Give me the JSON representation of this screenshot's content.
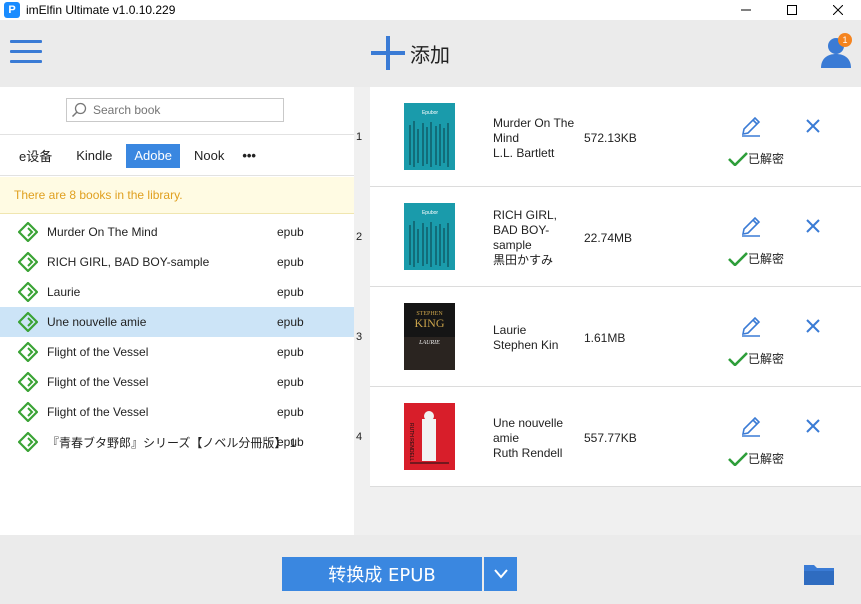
{
  "window": {
    "title": "imElfin Ultimate v1.0.10.229",
    "app_icon_letter": "P",
    "minimize_icon": "minimize-icon",
    "maximize_icon": "maximize-icon",
    "close_icon": "close-icon"
  },
  "header": {
    "add_label": "添加",
    "notification_count": "1",
    "accent_color": "#3a7bd5",
    "badge_color": "#f5841f"
  },
  "search": {
    "placeholder": "Search book"
  },
  "tabs": [
    {
      "label": "e设备",
      "active": false
    },
    {
      "label": "Kindle",
      "active": false
    },
    {
      "label": "Adobe",
      "active": true
    },
    {
      "label": "Nook",
      "active": false
    },
    {
      "label": "•••",
      "active": false
    }
  ],
  "notice": "There are 8 books in the library.",
  "library": [
    {
      "title": "Murder On The Mind",
      "format": "epub",
      "selected": false
    },
    {
      "title": "RICH GIRL, BAD BOY-sample",
      "format": "epub",
      "selected": false
    },
    {
      "title": "Laurie",
      "format": "epub",
      "selected": false
    },
    {
      "title": "Une nouvelle amie",
      "format": "epub",
      "selected": true
    },
    {
      "title": "Flight of the Vessel",
      "format": "epub",
      "selected": false
    },
    {
      "title": "Flight of the Vessel",
      "format": "epub",
      "selected": false
    },
    {
      "title": "Flight of the Vessel",
      "format": "epub",
      "selected": false
    },
    {
      "title": "『青春ブタ野郎』シリーズ【ノベル分冊版】 1",
      "format": "epub",
      "selected": false
    }
  ],
  "conversion": [
    {
      "num": "1",
      "lines": [
        "Murder On The",
        "Mind",
        "L.L. Bartlett"
      ],
      "size": "572.13KB",
      "status": "已解密",
      "cover": "epubor"
    },
    {
      "num": "2",
      "lines": [
        "RICH GIRL,",
        "BAD BOY-",
        "sample",
        "黒田かすみ"
      ],
      "size": "22.74MB",
      "status": "已解密",
      "cover": "epubor"
    },
    {
      "num": "3",
      "lines": [
        "Laurie",
        "Stephen Kin"
      ],
      "size": "1.61MB",
      "status": "已解密",
      "cover": "king",
      "cover_author": "STEPHEN",
      "cover_name": "KING",
      "cover_title": "LAURIE"
    },
    {
      "num": "4",
      "lines": [
        "Une nouvelle",
        "amie",
        "Ruth Rendell"
      ],
      "size": "557.77KB",
      "status": "已解密",
      "cover": "rendell",
      "cover_text": "RUTH RENDELL"
    }
  ],
  "footer": {
    "convert_label": "转换成 EPUB",
    "dropdown_icon": "chevron-down-icon",
    "folder_icon": "folder-icon"
  }
}
